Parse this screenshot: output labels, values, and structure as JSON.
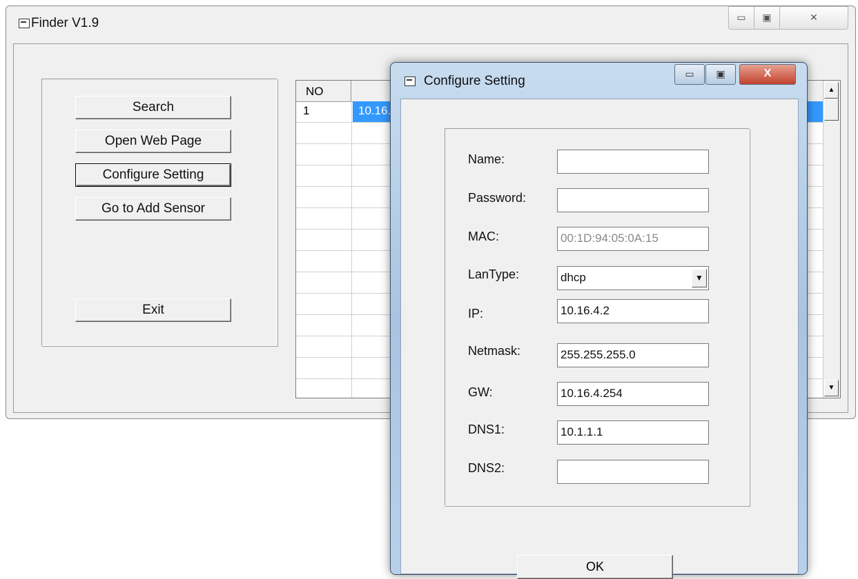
{
  "main_window": {
    "title": "Finder V1.9",
    "controls": {
      "minimize": "▭",
      "maximize": "▣",
      "close": "✕"
    }
  },
  "buttons": {
    "search": "Search",
    "open_web_page": "Open Web Page",
    "configure_setting": "Configure Setting",
    "go_to_add_sensor": "Go to Add Sensor",
    "exit": "Exit"
  },
  "grid": {
    "header_no": "NO",
    "rows": [
      {
        "no": "1",
        "ip": "10.16."
      }
    ]
  },
  "dialog": {
    "title": "Configure Setting",
    "controls": {
      "minimize": "▭",
      "maximize": "▣",
      "close": "X"
    },
    "labels": {
      "name": "Name:",
      "password": "Password:",
      "mac": "MAC:",
      "lantype": "LanType:",
      "ip": "IP:",
      "netmask": "Netmask:",
      "gw": "GW:",
      "dns1": "DNS1:",
      "dns2": "DNS2:"
    },
    "values": {
      "name": "",
      "password": "",
      "mac": "00:1D:94:05:0A:15",
      "lantype": "dhcp",
      "ip": "10.16.4.2",
      "netmask": "255.255.255.0",
      "gw": "10.16.4.254",
      "dns1": "10.1.1.1",
      "dns2": ""
    },
    "ok": "OK"
  },
  "colors": {
    "selection": "#3399ff",
    "window_bg": "#f0f0f0"
  }
}
